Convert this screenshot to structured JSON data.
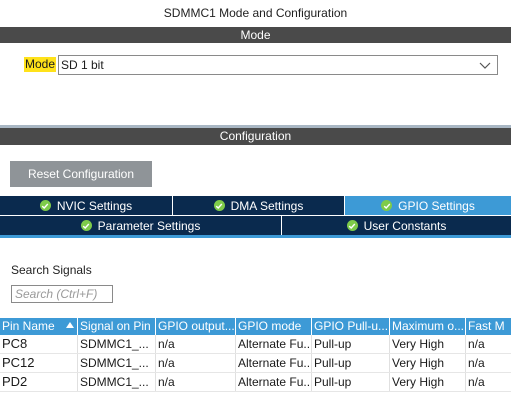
{
  "window": {
    "title": "SDMMC1 Mode and Configuration"
  },
  "mode_section": {
    "header": "Mode",
    "label": "Mode",
    "selected": "SD 1 bit"
  },
  "config_section": {
    "header": "Configuration",
    "reset_label": "Reset Configuration"
  },
  "tabs": {
    "row1": [
      {
        "label": "NVIC Settings",
        "active": false
      },
      {
        "label": "DMA Settings",
        "active": false
      },
      {
        "label": "GPIO Settings",
        "active": true
      }
    ],
    "row2": [
      {
        "label": "Parameter Settings",
        "active": false
      },
      {
        "label": "User Constants",
        "active": false
      }
    ]
  },
  "search": {
    "label": "Search Signals",
    "placeholder": "Search (Ctrl+F)"
  },
  "table": {
    "columns": [
      "Pin Name",
      "Signal on Pin",
      "GPIO output...",
      "GPIO mode",
      "GPIO Pull-u...",
      "Maximum o...",
      "Fast M"
    ],
    "rows": [
      [
        "PC8",
        "SDMMC1_...",
        "n/a",
        "Alternate Fu...",
        "Pull-up",
        "Very High",
        "n/a"
      ],
      [
        "PC12",
        "SDMMC1_...",
        "n/a",
        "Alternate Fu...",
        "Pull-up",
        "Very High",
        "n/a"
      ],
      [
        "PD2",
        "SDMMC1_...",
        "n/a",
        "Alternate Fu...",
        "Pull-up",
        "Very High",
        "n/a"
      ]
    ]
  },
  "colors": {
    "header_bar": "#4a4a4a",
    "tab_inactive": "#0a2a4e",
    "tab_active": "#3d9ad6",
    "check": "#7ecb4a",
    "mode_highlight": "#ffe21a",
    "reset_button": "#8f9498"
  },
  "icons": {
    "tab_status": "check-circle-icon",
    "dropdown": "chevron-down-icon",
    "sort": "sort-ascending-icon"
  }
}
